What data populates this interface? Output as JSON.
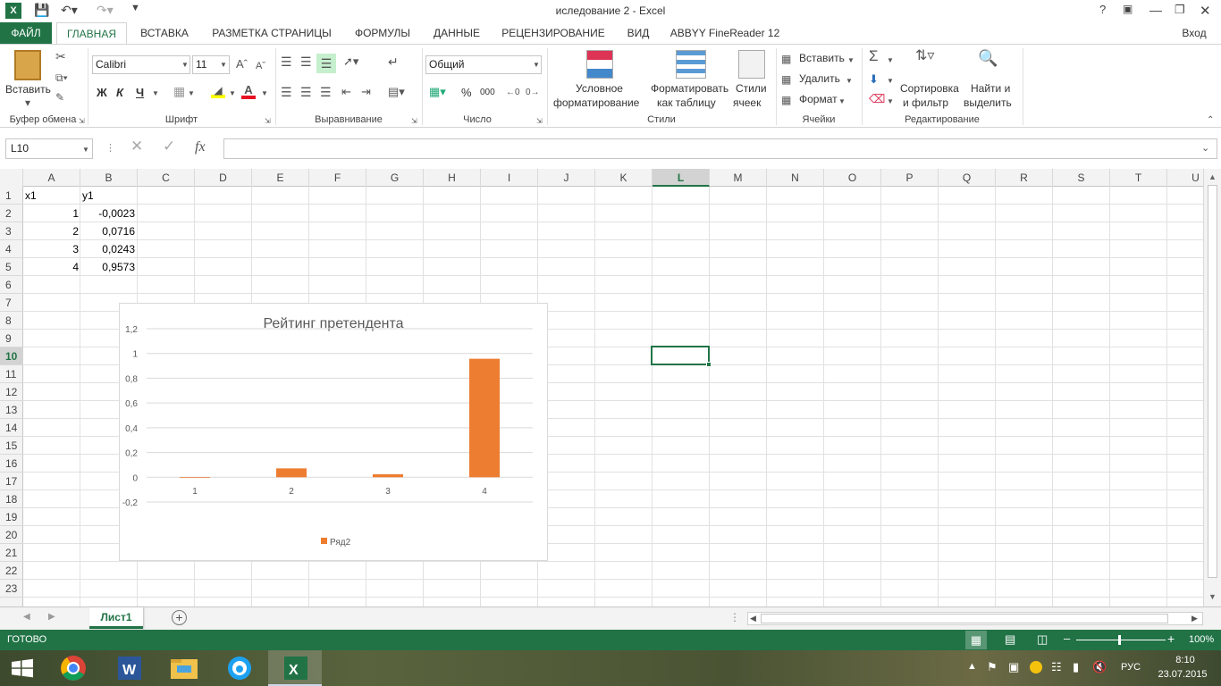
{
  "window": {
    "title": "иследование 2 - Excel",
    "help": "?",
    "signin": "Вход"
  },
  "ribbon_tabs": [
    "ФАЙЛ",
    "ГЛАВНАЯ",
    "ВСТАВКА",
    "РАЗМЕТКА СТРАНИЦЫ",
    "ФОРМУЛЫ",
    "ДАННЫЕ",
    "РЕЦЕНЗИРОВАНИЕ",
    "ВИД",
    "ABBYY FineReader 12"
  ],
  "clipboard": {
    "paste": "Вставить",
    "label": "Буфер обмена"
  },
  "font": {
    "name": "Calibri",
    "size": "11",
    "bold": "Ж",
    "italic": "К",
    "underline": "Ч",
    "label": "Шрифт"
  },
  "alignment": {
    "label": "Выравнивание"
  },
  "number": {
    "format": "Общий",
    "percent": "%",
    "thousands": "000",
    "label": "Число"
  },
  "styles": {
    "conditional": "Условное",
    "conditional2": "форматирование",
    "as_table": "Форматировать",
    "as_table2": "как таблицу",
    "cell_styles": "Стили",
    "cell_styles2": "ячеек",
    "label": "Стили"
  },
  "cells_group": {
    "insert": "Вставить",
    "delete": "Удалить",
    "format": "Формат",
    "label": "Ячейки"
  },
  "editing": {
    "sort": "Сортировка",
    "sort2": "и фильтр",
    "find": "Найти и",
    "find2": "выделить",
    "label": "Редактирование"
  },
  "formula_bar": {
    "name_box": "L10",
    "fx": "fx",
    "value": ""
  },
  "columns": [
    "A",
    "B",
    "C",
    "D",
    "E",
    "F",
    "G",
    "H",
    "I",
    "J",
    "K",
    "L",
    "M",
    "N",
    "O",
    "P",
    "Q",
    "R",
    "S",
    "T",
    "U"
  ],
  "rows": [
    "1",
    "2",
    "3",
    "4",
    "5",
    "6",
    "7",
    "8",
    "9",
    "10",
    "11",
    "12",
    "13",
    "14",
    "15",
    "16",
    "17",
    "18",
    "19",
    "20",
    "21",
    "22",
    "23"
  ],
  "sheet": {
    "headers": [
      "x1",
      "y1"
    ],
    "x": [
      "1",
      "2",
      "3",
      "4"
    ],
    "y": [
      "-0,0023",
      "0,0716",
      "0,0243",
      "0,9573"
    ]
  },
  "chart_data": {
    "type": "bar",
    "title": "Рейтинг претендента",
    "categories": [
      "1",
      "2",
      "3",
      "4"
    ],
    "series": [
      {
        "name": "Ряд2",
        "values": [
          -0.0023,
          0.0716,
          0.0243,
          0.9573
        ]
      }
    ],
    "ylim": [
      -0.2,
      1.2
    ],
    "yticks": [
      "1,2",
      "1",
      "0,8",
      "0,6",
      "0,4",
      "0,2",
      "0",
      "-0,2"
    ],
    "grid": true,
    "legend": "bottom",
    "colors": {
      "bar": "#ed7d31"
    }
  },
  "sheet_tabs": {
    "active": "Лист1",
    "add": "+"
  },
  "status": {
    "ready": "ГОТОВО",
    "zoom": "100%"
  },
  "taskbar": {
    "lang": "РУС",
    "time": "8:10",
    "date": "23.07.2015"
  },
  "colors": {
    "accent": "#217346",
    "bar": "#ed7d31"
  }
}
